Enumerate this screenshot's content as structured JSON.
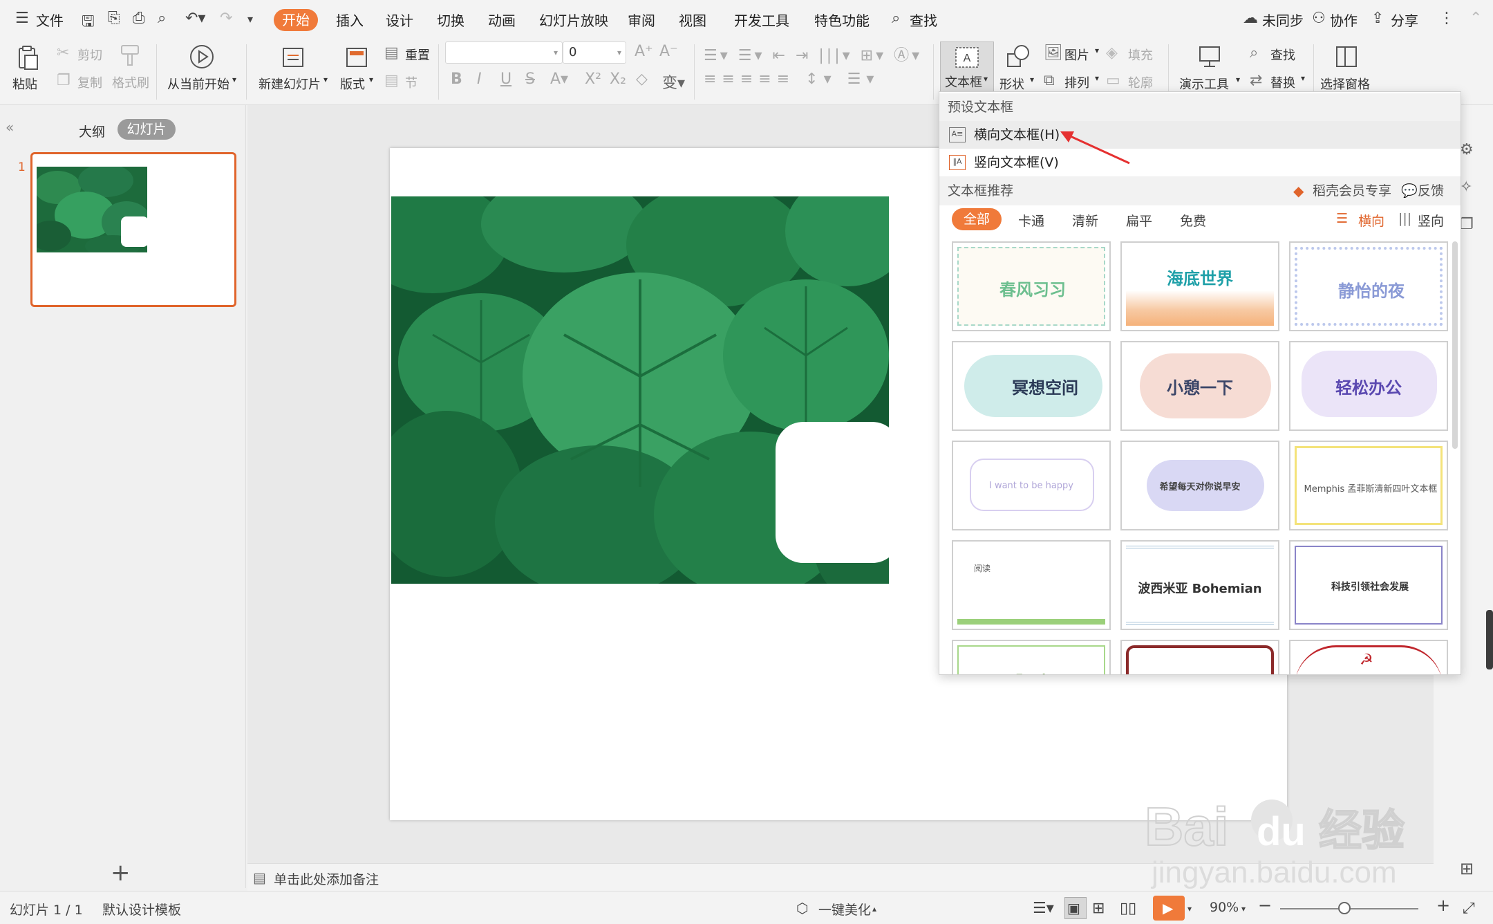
{
  "menubar": {
    "file": "文件",
    "tabs": [
      "开始",
      "插入",
      "设计",
      "切换",
      "动画",
      "幻灯片放映",
      "审阅",
      "视图",
      "开发工具",
      "特色功能"
    ],
    "search": "查找",
    "sync": "未同步",
    "collab": "协作",
    "share": "分享"
  },
  "ribbon": {
    "paste": "粘贴",
    "cut": "剪切",
    "copy": "复制",
    "format_painter": "格式刷",
    "from_current": "从当前开始",
    "new_slide": "新建幻灯片",
    "layout": "版式",
    "reset": "重置",
    "section": "节",
    "font_name": "",
    "font_size": "0",
    "textbox": "文本框",
    "shape": "形状",
    "picture": "图片",
    "arrange": "排列",
    "fill": "填充",
    "outline": "轮廓",
    "present_tools": "演示工具",
    "find": "查找",
    "replace": "替换",
    "select_pane": "选择窗格"
  },
  "leftpanel": {
    "outline": "大纲",
    "slides": "幻灯片",
    "thumb_number": "1"
  },
  "notes": {
    "placeholder": "单击此处添加备注"
  },
  "status": {
    "slide_counter": "幻灯片 1 / 1",
    "template": "默认设计模板",
    "beautify": "一键美化",
    "zoom": "90%"
  },
  "dropdown": {
    "preset_header": "预设文本框",
    "horizontal": "横向文本框(H)",
    "vertical": "竖向文本框(V)",
    "recommend_header": "文本框推荐",
    "member": "稻壳会员专享",
    "feedback": "反馈",
    "filters": [
      "全部",
      "卡通",
      "清新",
      "扁平",
      "免费"
    ],
    "orient_horizontal": "横向",
    "orient_vertical": "竖向",
    "cards": [
      {
        "label": "春风习习",
        "color": "#6dbf8f"
      },
      {
        "label": "海底世界",
        "color": "#1fa0a8"
      },
      {
        "label": "静怡的夜",
        "color": "#8a9ad6"
      },
      {
        "label": "冥想空间",
        "color": "#2b3a57"
      },
      {
        "label": "小憩一下",
        "color": "#3a4568"
      },
      {
        "label": "轻松办公",
        "color": "#5a48b0"
      },
      {
        "label": "I want to be happy",
        "color": "#b0a6d8"
      },
      {
        "label": "希望每天对你说早安",
        "color": "#444444"
      },
      {
        "label": "Memphis 孟菲斯清新四叶文本框",
        "color": "#555555"
      },
      {
        "label": "阅读",
        "color": "#555555"
      },
      {
        "label": "波西米亚 Bohemian",
        "color": "#333333"
      },
      {
        "label": "科技引领社会发展",
        "color": "#333333"
      },
      {
        "label": "Fresh",
        "color": "#6b9c4a"
      },
      {
        "label": "",
        "color": "#8b2a2a"
      },
      {
        "label": "",
        "color": "#c0272d"
      }
    ]
  },
  "watermark": {
    "brand": "Bai",
    "brand2": "du",
    "cn": "经验",
    "url": "jingyan.baidu.com"
  },
  "colors": {
    "accent": "#f07a3a",
    "thumb_border": "#e0642b",
    "leaf_dark": "#0f4a2a",
    "leaf_light": "#3aa163"
  }
}
